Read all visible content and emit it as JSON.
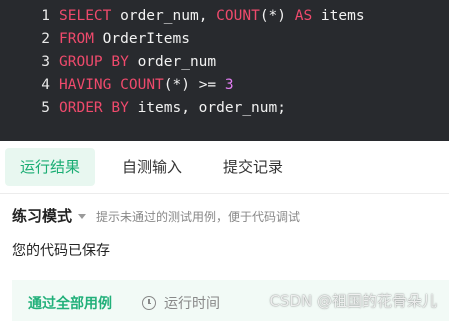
{
  "editor": {
    "lines": [
      {
        "num": "1",
        "tokens": [
          {
            "t": "SELECT",
            "k": "kw"
          },
          {
            "t": " order_num, ",
            "k": "plain"
          },
          {
            "t": "COUNT",
            "k": "kw"
          },
          {
            "t": "(*) ",
            "k": "plain"
          },
          {
            "t": "AS",
            "k": "kw"
          },
          {
            "t": " items",
            "k": "plain"
          }
        ]
      },
      {
        "num": "2",
        "tokens": [
          {
            "t": "FROM",
            "k": "kw"
          },
          {
            "t": " OrderItems",
            "k": "plain"
          }
        ]
      },
      {
        "num": "3",
        "tokens": [
          {
            "t": "GROUP BY",
            "k": "kw"
          },
          {
            "t": " order_num",
            "k": "plain"
          }
        ]
      },
      {
        "num": "4",
        "tokens": [
          {
            "t": "HAVING",
            "k": "kw"
          },
          {
            "t": " ",
            "k": "plain"
          },
          {
            "t": "COUNT",
            "k": "kw"
          },
          {
            "t": "(*) >= ",
            "k": "plain"
          },
          {
            "t": "3",
            "k": "num"
          }
        ]
      },
      {
        "num": "5",
        "tokens": [
          {
            "t": "ORDER BY",
            "k": "kw"
          },
          {
            "t": " items, order_num;",
            "k": "plain"
          }
        ]
      }
    ]
  },
  "tabs": {
    "run_result": "运行结果",
    "self_test": "自测输入",
    "submit_log": "提交记录"
  },
  "results": {
    "mode_label": "练习模式",
    "mode_hint": "提示未通过的测试用例，便于代码调试",
    "saved_text": "您的代码已保存",
    "pass_text": "通过全部用例",
    "runtime_text": "运行时间"
  },
  "watermark": "CSDN @祖国的花骨朵儿",
  "colors": {
    "editor_bg": "#282a2e",
    "keyword": "#ef4a6c",
    "number": "#e07cf0",
    "accent_green": "#1aad73",
    "active_tab_bg": "#e8f7f0"
  }
}
